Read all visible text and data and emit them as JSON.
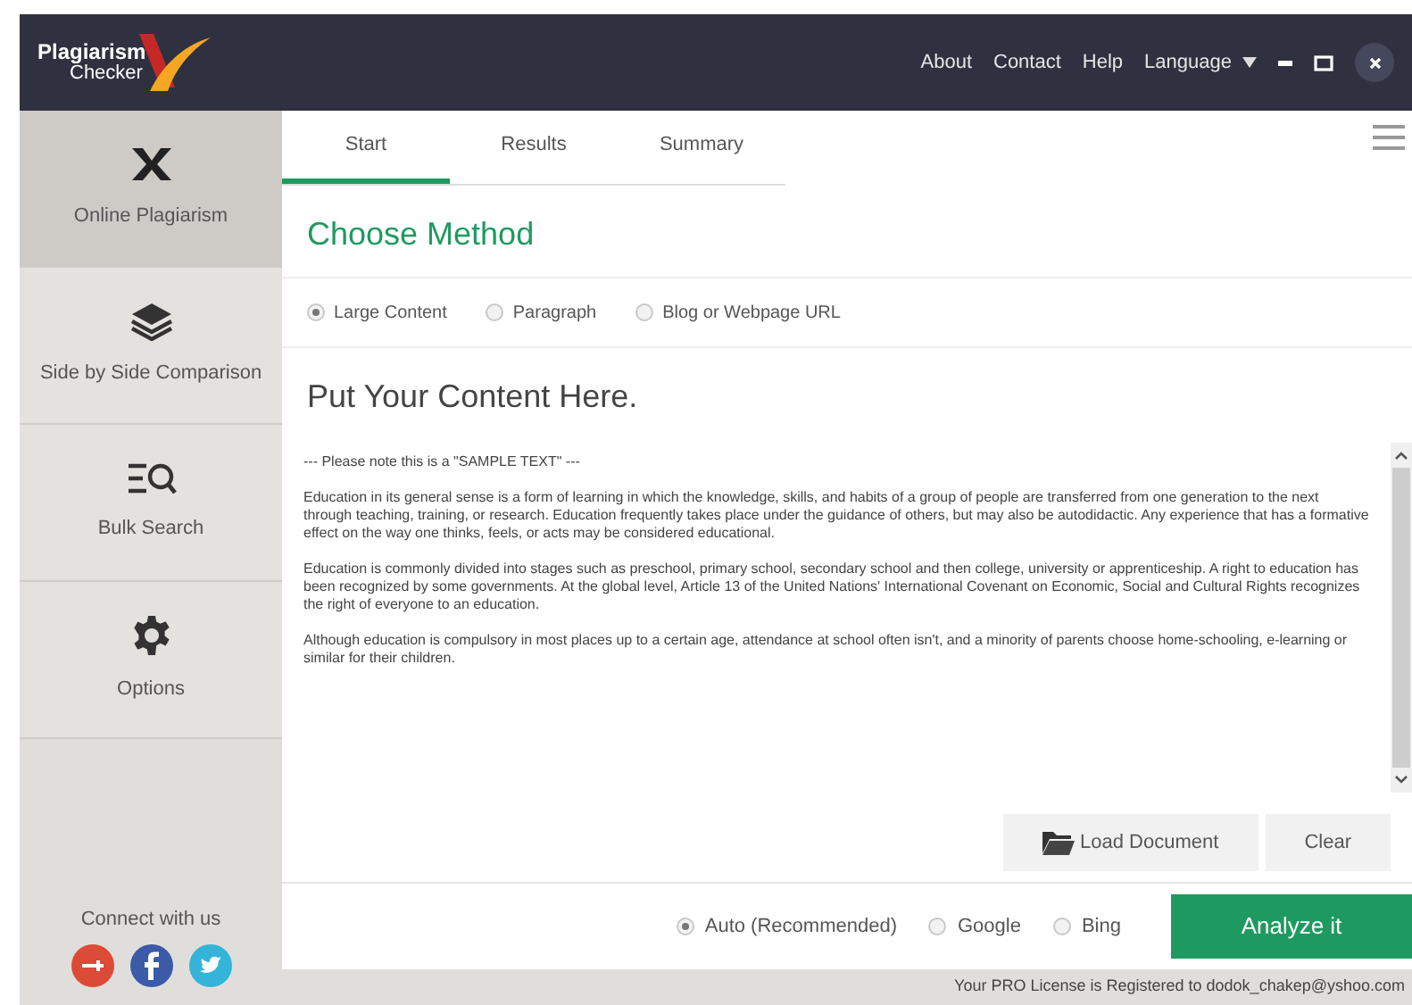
{
  "window": {
    "logo_line_1": "Plagiarism",
    "logo_line_2": "Checker"
  },
  "top_menu": [
    "About",
    "Contact",
    "Help",
    "Language"
  ],
  "sidebar": {
    "items": [
      {
        "kind": "x",
        "label": "Online Plagiarism",
        "selected": true
      },
      {
        "kind": "layers",
        "label": "Side by Side Comparison",
        "selected": false
      },
      {
        "kind": "bulk",
        "label": "Bulk Search",
        "selected": false
      },
      {
        "kind": "gear",
        "label": "Options",
        "selected": false
      }
    ],
    "connect_label": "Connect with us"
  },
  "tabs": [
    {
      "label": "Start",
      "selected": true
    },
    {
      "label": "Results",
      "selected": false
    },
    {
      "label": "Summary",
      "selected": false
    }
  ],
  "method": {
    "title": "Choose Method",
    "options": [
      {
        "label": "Large Content",
        "selected": true
      },
      {
        "label": "Paragraph",
        "selected": false
      },
      {
        "label": "Blog or Webpage URL",
        "selected": false
      }
    ]
  },
  "content": {
    "title": "Put Your Content Here.",
    "paragraphs": [
      "--- Please note this is a \"SAMPLE TEXT\" ---",
      "Education in its general sense is a form of learning in which the knowledge, skills, and habits of a group of people are transferred from one generation to the next through teaching, training, or research. Education frequently takes place under the guidance of others, but may also be autodidactic. Any experience that has a formative effect on the way one thinks, feels, or acts may be considered educational.",
      "Education is commonly divided into stages such as preschool, primary school, secondary school and then college, university or apprenticeship. A right to education has been recognized by some governments. At the global level, Article 13 of the United Nations' International Covenant on Economic, Social and Cultural Rights recognizes the right of everyone to an education.",
      "Although education is compulsory in most places up to a certain age, attendance at school often isn't, and a minority of parents choose home-schooling, e-learning or similar for their children."
    ]
  },
  "actions": {
    "load": "Load Document",
    "clear": "Clear"
  },
  "engines": [
    {
      "label": "Auto (Recommended)",
      "selected": true
    },
    {
      "label": "Google",
      "selected": false
    },
    {
      "label": "Bing",
      "selected": false
    }
  ],
  "analyze": "Analyze it",
  "status_bar": "Your PRO License is Registered to dodok_chakep@yshoo.com"
}
